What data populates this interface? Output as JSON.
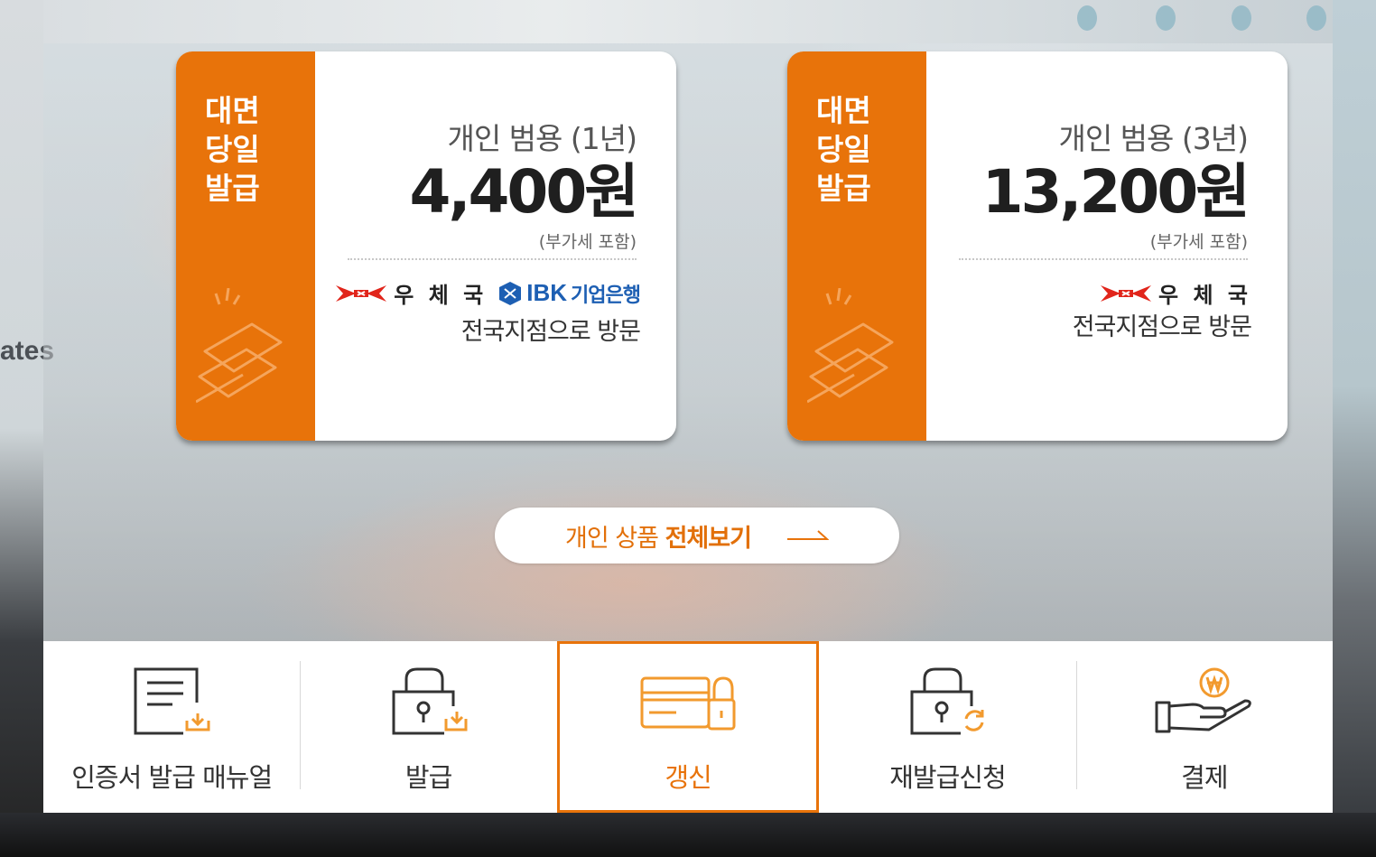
{
  "background": {
    "edge_text": "ates"
  },
  "colors": {
    "accent": "#e8730a",
    "ibk_blue": "#1d5fb3",
    "post_red": "#e1251b"
  },
  "cards": [
    {
      "badge": [
        "대면",
        "당일",
        "발급"
      ],
      "plan": "개인 범용 (1년)",
      "price": "4,400원",
      "vat": "(부가세 포함)",
      "partners": [
        "우 체 국",
        "IBK",
        "기업은행"
      ],
      "visit": "전국지점으로 방문"
    },
    {
      "badge": [
        "대면",
        "당일",
        "발급"
      ],
      "plan": "개인 범용 (3년)",
      "price": "13,200원",
      "vat": "(부가세 포함)",
      "partners": [
        "우 체 국"
      ],
      "visit": "전국지점으로 방문"
    }
  ],
  "view_all": {
    "prefix": "개인 상품 ",
    "bold": "전체보기",
    "icon": "long-arrow-right-icon"
  },
  "menu": {
    "active_index": 2,
    "items": [
      {
        "label": "인증서 발급 매뉴얼",
        "icon": "document-download-icon"
      },
      {
        "label": "발급",
        "icon": "lock-download-icon"
      },
      {
        "label": "갱신",
        "icon": "card-lock-icon"
      },
      {
        "label": "재발급신청",
        "icon": "lock-refresh-icon"
      },
      {
        "label": "결제",
        "icon": "hand-coin-icon"
      }
    ]
  }
}
